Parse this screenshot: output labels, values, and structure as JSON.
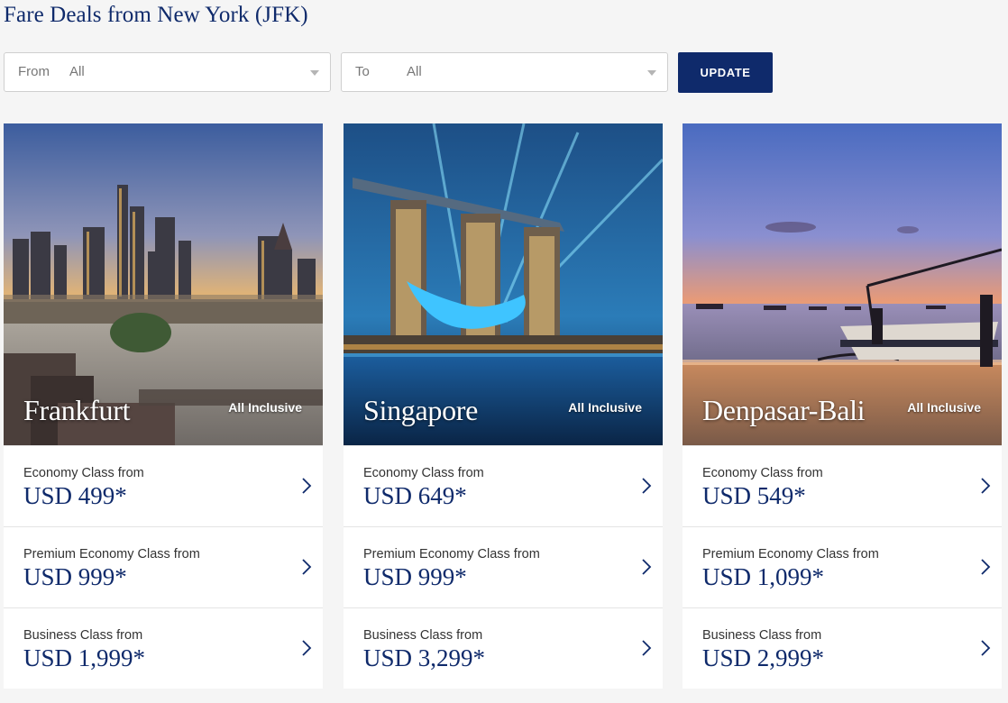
{
  "page": {
    "title": "Fare Deals from New York (JFK)"
  },
  "filters": {
    "from_label": "From",
    "from_value": "All",
    "to_label": "To",
    "to_value": "All",
    "update_label": "UPDATE"
  },
  "colors": {
    "brand_navy": "#0f2a6b",
    "background": "#f5f5f5"
  },
  "deals": [
    {
      "city": "Frankfurt",
      "badge": "All Inclusive",
      "fares": [
        {
          "class": "Economy Class from",
          "price": "USD 499*"
        },
        {
          "class": "Premium Economy Class from",
          "price": "USD 999*"
        },
        {
          "class": "Business Class from",
          "price": "USD 1,999*"
        }
      ]
    },
    {
      "city": "Singapore",
      "badge": "All Inclusive",
      "fares": [
        {
          "class": "Economy Class from",
          "price": "USD 649*"
        },
        {
          "class": "Premium Economy Class from",
          "price": "USD 999*"
        },
        {
          "class": "Business Class from",
          "price": "USD 3,299*"
        }
      ]
    },
    {
      "city": "Denpasar-Bali",
      "badge": "All Inclusive",
      "fares": [
        {
          "class": "Economy Class from",
          "price": "USD 549*"
        },
        {
          "class": "Premium Economy Class from",
          "price": "USD 1,099*"
        },
        {
          "class": "Business Class from",
          "price": "USD 2,999*"
        }
      ]
    }
  ],
  "icons": {
    "fare_row_arrow": "chevron-right-icon",
    "dropdown_caret": "caret-down-icon"
  }
}
